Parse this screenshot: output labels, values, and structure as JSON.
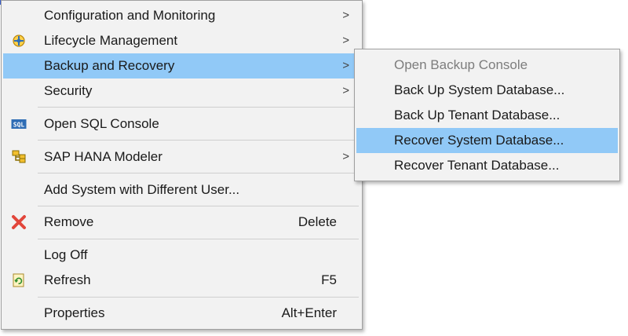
{
  "main_menu": {
    "items": [
      {
        "label": "Configuration and Monitoring",
        "submenu": true
      },
      {
        "label": "Lifecycle Management",
        "submenu": true,
        "icon": "lifecycle-icon"
      },
      {
        "label": "Backup and Recovery",
        "submenu": true,
        "highlighted": true
      },
      {
        "label": "Security",
        "submenu": true
      },
      {
        "label": "Open SQL Console",
        "icon": "sql-console-icon",
        "icon_text": "SQL"
      },
      {
        "label": "SAP HANA Modeler",
        "submenu": true,
        "icon": "modeler-icon"
      },
      {
        "label": "Add System with Different User..."
      },
      {
        "label": "Remove",
        "shortcut": "Delete",
        "icon": "remove-icon"
      },
      {
        "label": "Log Off"
      },
      {
        "label": "Refresh",
        "shortcut": "F5",
        "icon": "refresh-icon"
      },
      {
        "label": "Properties",
        "shortcut": "Alt+Enter"
      }
    ],
    "submenu_arrow": ">"
  },
  "sub_menu": {
    "items": [
      {
        "label": "Open Backup Console",
        "disabled": true
      },
      {
        "label": "Back Up System Database..."
      },
      {
        "label": "Back Up Tenant Database..."
      },
      {
        "label": "Recover System Database...",
        "highlighted": true
      },
      {
        "label": "Recover Tenant Database..."
      }
    ]
  },
  "colors": {
    "highlight": "#91c9f7",
    "menu_background": "#f2f2f2",
    "disabled_text": "#7d7d7d",
    "remove_icon": "#e2463b"
  }
}
